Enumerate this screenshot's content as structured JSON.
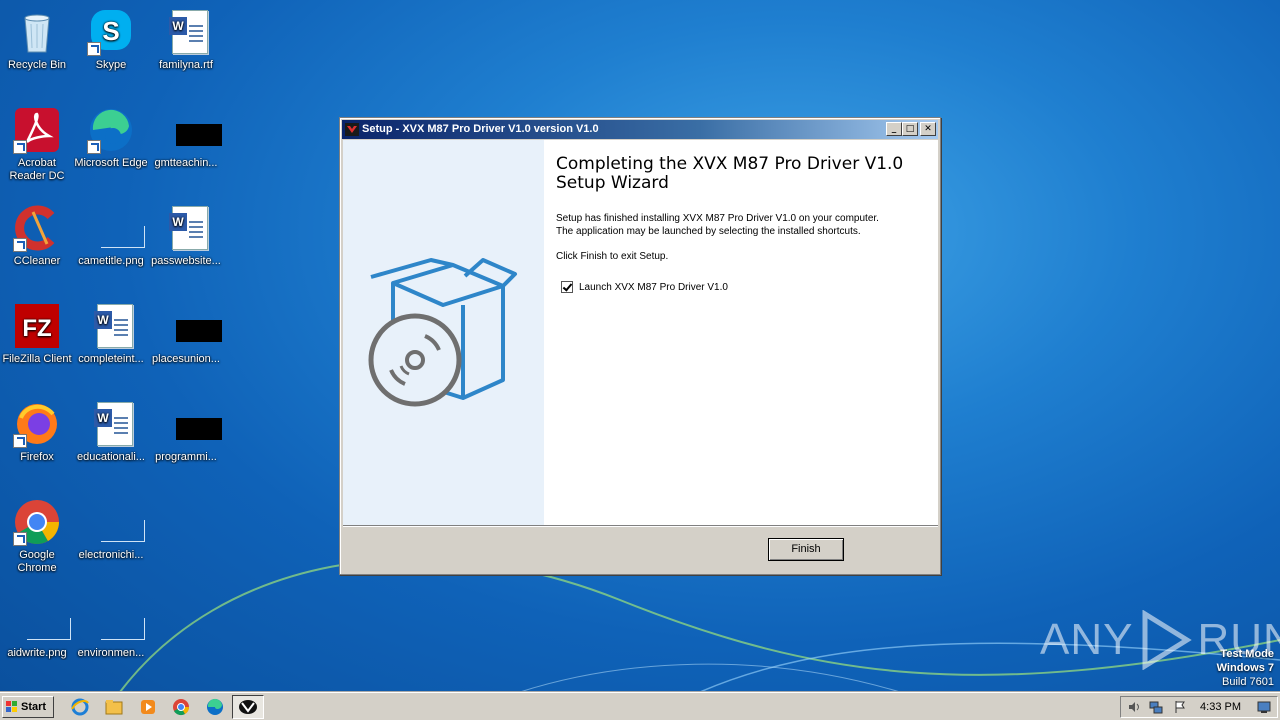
{
  "desktop": {
    "icons": [
      {
        "label": "Recycle Bin"
      },
      {
        "label": "Skype"
      },
      {
        "label": "familyna.rtf"
      },
      {
        "label": "Acrobat Reader DC"
      },
      {
        "label": "Microsoft Edge"
      },
      {
        "label": "gmtteachin..."
      },
      {
        "label": "CCleaner"
      },
      {
        "label": "cametitle.png"
      },
      {
        "label": "passwebsite..."
      },
      {
        "label": "FileZilla Client"
      },
      {
        "label": "completeint..."
      },
      {
        "label": "placesunion..."
      },
      {
        "label": "Firefox"
      },
      {
        "label": "educationali..."
      },
      {
        "label": "programmi..."
      },
      {
        "label": "Google Chrome"
      },
      {
        "label": "electronichi..."
      },
      {
        "label": "aidwrite.png"
      },
      {
        "label": "environmen..."
      }
    ]
  },
  "window": {
    "title": "Setup - XVX M87 Pro Driver V1.0 version V1.0",
    "heading": "Completing the XVX M87 Pro Driver V1.0 Setup Wizard",
    "body_line1": "Setup has finished installing XVX M87 Pro Driver V1.0 on your computer.",
    "body_line2": "The application may be launched by selecting the installed shortcuts.",
    "click_finish": "Click Finish to exit Setup.",
    "launch_label": "Launch XVX M87 Pro Driver V1.0",
    "launch_checked": true,
    "finish_label": "Finish",
    "minimize_glyph": "_",
    "maximize_glyph": "□",
    "close_glyph": "✕"
  },
  "watermark": {
    "left": "ANY",
    "right": "RUN"
  },
  "system": {
    "test_mode": "Test Mode",
    "os": "Windows 7",
    "build": "Build 7601"
  },
  "taskbar": {
    "start_label": "Start",
    "clock": "4:33 PM"
  },
  "colors": {
    "title_start": "#0a246a",
    "title_end": "#a6caf0",
    "illustration_blue": "#2e86c9",
    "illustration_gray": "#6f6f6f"
  }
}
